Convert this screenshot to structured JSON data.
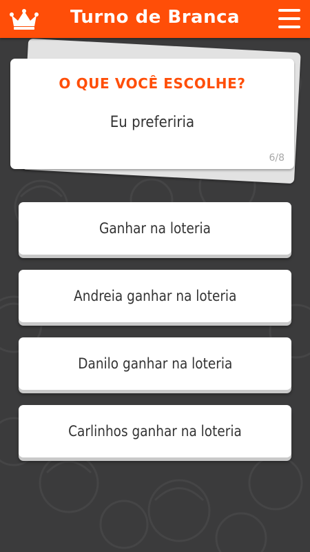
{
  "header": {
    "title": "Turno de Branca",
    "left_icon": "crown-icon",
    "right_icon": "hamburger-menu-icon"
  },
  "question": {
    "title": "O QUE VOCÊ ESCOLHE?",
    "prompt": "Eu preferiria",
    "progress": "6/8"
  },
  "options": [
    {
      "label": "Ganhar na loteria"
    },
    {
      "label": "Andreia ganhar na loteria"
    },
    {
      "label": "Danilo ganhar na loteria"
    },
    {
      "label": "Carlinhos ganhar na loteria"
    }
  ],
  "colors": {
    "accent": "#ff4e08",
    "background": "#3b3b3c",
    "card": "#ffffff",
    "text": "#333333",
    "muted": "#a7a7a7"
  }
}
